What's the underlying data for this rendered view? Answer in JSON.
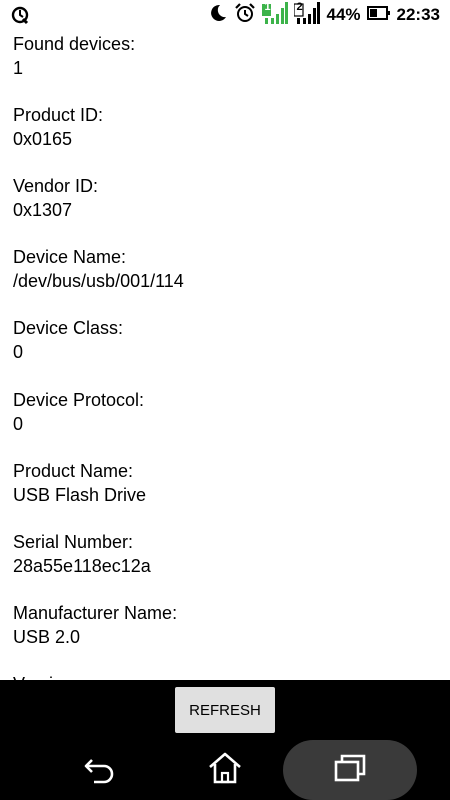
{
  "status_bar": {
    "battery_percent": "44%",
    "time": "22:33",
    "sim1": "1",
    "sim2": "2",
    "icons": [
      "sync-icon",
      "moon-icon",
      "alarm-icon",
      "signal-sim1-icon",
      "signal-sim2-icon",
      "battery-icon"
    ]
  },
  "fields": [
    {
      "label": "Found devices:",
      "value": "1"
    },
    {
      "label": "Product ID:",
      "value": "0x0165"
    },
    {
      "label": "Vendor ID:",
      "value": "0x1307"
    },
    {
      "label": "Device Name:",
      "value": "/dev/bus/usb/001/114"
    },
    {
      "label": "Device Class:",
      "value": "0"
    },
    {
      "label": "Device Protocol:",
      "value": "0"
    },
    {
      "label": "Product Name:",
      "value": "USB Flash Drive"
    },
    {
      "label": "Serial Number:",
      "value": "28a55e118ec12a"
    },
    {
      "label": "Manufacturer Name:",
      "value": "USB 2.0"
    },
    {
      "label": "Version:",
      "value": ""
    }
  ],
  "refresh_button": {
    "label": "REFRESH"
  },
  "nav": {
    "icons": [
      "back-icon",
      "home-icon",
      "recent-apps-icon"
    ]
  },
  "colors": {
    "accent": "#3cb34a",
    "background": "#ffffff",
    "button": "#e0e0e0"
  }
}
